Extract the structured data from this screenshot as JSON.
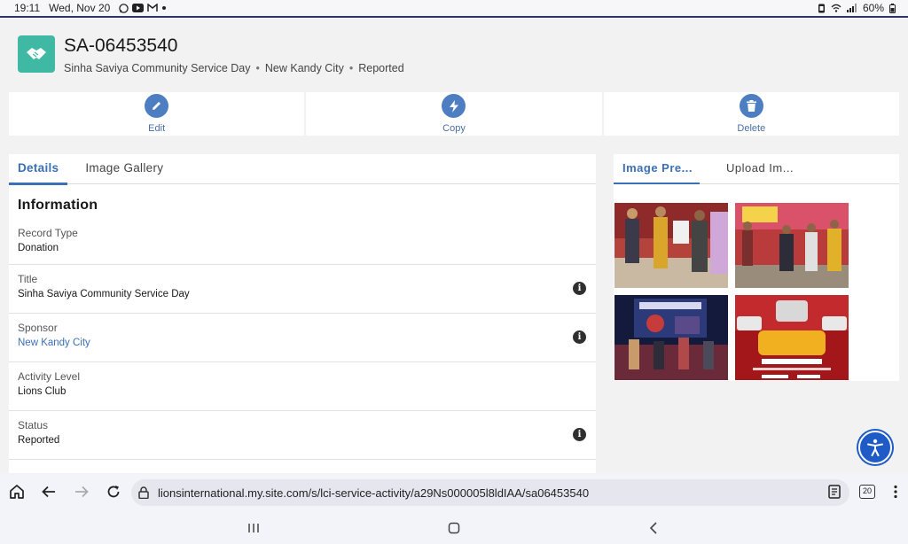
{
  "status_bar": {
    "time": "19:11",
    "date": "Wed, Nov 20",
    "notification_icons": [
      "whatsapp-icon",
      "youtube-icon",
      "gmail-icon",
      "dot-icon"
    ],
    "right_icons": [
      "vibrate-icon",
      "wifi-icon",
      "signal-icon"
    ],
    "battery": "60%"
  },
  "record": {
    "number": "SA-06453540",
    "name": "Sinha Saviya Community Service Day",
    "sponsor": "New Kandy City",
    "status": "Reported",
    "separator": "•"
  },
  "actions": [
    {
      "label": "Edit",
      "icon": "pencil-icon"
    },
    {
      "label": "Copy",
      "icon": "lightning-icon"
    },
    {
      "label": "Delete",
      "icon": "trash-icon"
    }
  ],
  "details_tabs": [
    {
      "label": "Details",
      "active": true
    },
    {
      "label": "Image Gallery",
      "active": false
    }
  ],
  "section_title": "Information",
  "fields": [
    {
      "label": "Record Type",
      "value": "Donation",
      "link": false,
      "info": false
    },
    {
      "label": "Title",
      "value": "Sinha Saviya Community Service Day",
      "link": false,
      "info": true
    },
    {
      "label": "Sponsor",
      "value": "New Kandy City",
      "link": true,
      "info": true
    },
    {
      "label": "Activity Level",
      "value": "Lions Club",
      "link": false,
      "info": false
    },
    {
      "label": "Status",
      "value": "Reported",
      "link": false,
      "info": true
    }
  ],
  "info_glyph": "i",
  "gallery_tabs": [
    {
      "label": "Image Pre...",
      "active": true
    },
    {
      "label": "Upload Im...",
      "active": false
    }
  ],
  "gallery_images": [
    "event-photo-award",
    "event-photo-group",
    "event-photo-stage",
    "event-poster"
  ],
  "browser": {
    "url": "lionsinternational.my.site.com/s/lci-service-activity/a29Ns000005l8ldIAA/sa06453540",
    "tab_count": "20"
  },
  "colors": {
    "accent": "#3b6fb6",
    "action_button": "#4d7ec1",
    "record_icon": "#3fb8a4",
    "accessibility": "#1e5bc6"
  }
}
